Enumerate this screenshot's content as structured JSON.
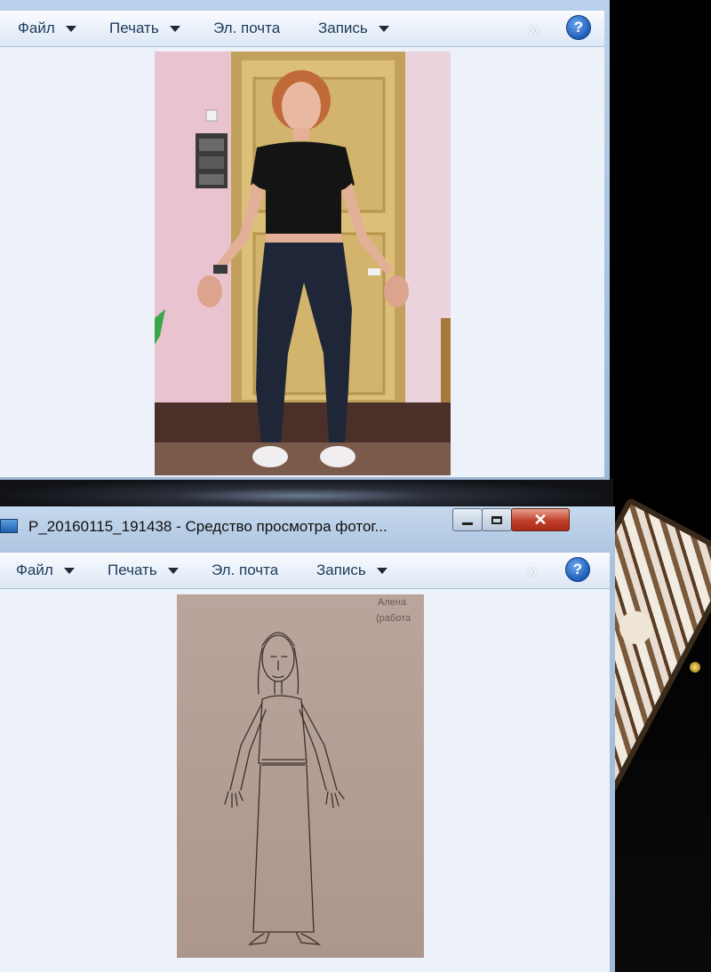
{
  "window_top": {
    "menu": {
      "file": "Файл",
      "print": "Печать",
      "email": "Эл. почта",
      "burn": "Запись",
      "help": "?"
    }
  },
  "window_bottom": {
    "title": "P_20160115_191438 - Средство просмотра фотог...",
    "menu": {
      "file": "Файл",
      "print": "Печать",
      "email": "Эл. почта",
      "burn": "Запись",
      "help": "?"
    }
  },
  "drawing_note": {
    "line1": "Алена",
    "line2": "(работа"
  },
  "icons": {
    "caret": "chevron-down-icon",
    "more": "double-chevron-right-icon",
    "help": "help-icon",
    "minimize": "minimize-icon",
    "maximize": "maximize-icon",
    "close": "close-icon",
    "app": "photo-viewer-icon"
  }
}
